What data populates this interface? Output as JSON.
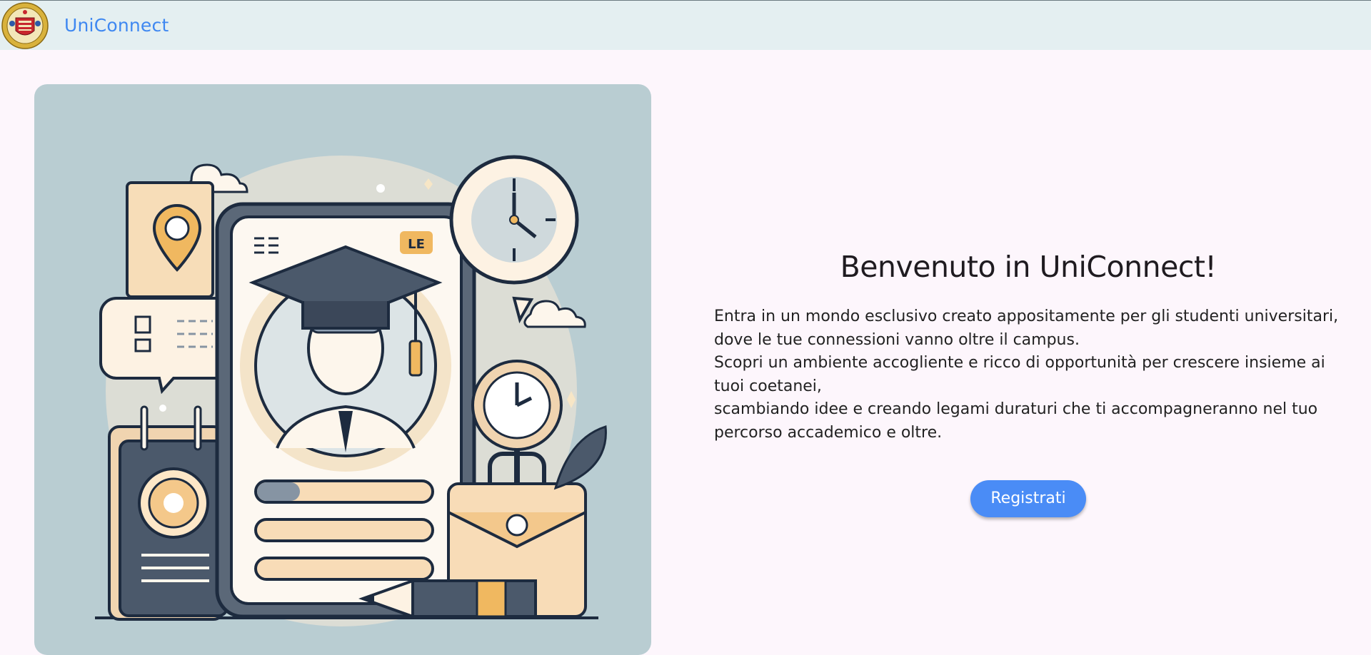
{
  "header": {
    "app_name": "UniConnect",
    "logo_icon": "university-crest-icon"
  },
  "hero": {
    "illustration": "graduate-profile-phone-illustration",
    "badge_text": "LE"
  },
  "welcome": {
    "title": "Benvenuto in UniConnect!",
    "lines": [
      "Entra in un mondo esclusivo creato appositamente per gli studenti universitari,",
      "dove le tue connessioni vanno oltre il campus.",
      "Scopri un ambiente accogliente e ricco di opportunità per crescere insieme ai tuoi coetanei,",
      "scambiando idee e creando legami duraturi che ti accompagneranno nel tuo percorso accademico e oltre."
    ],
    "register_label": "Registrati"
  },
  "colors": {
    "topbar_bg": "#e4eff1",
    "page_bg": "#fdf6fc",
    "brand": "#3f88f1",
    "button": "#4a8cf6",
    "hero_bg": "#b9cdd2"
  }
}
